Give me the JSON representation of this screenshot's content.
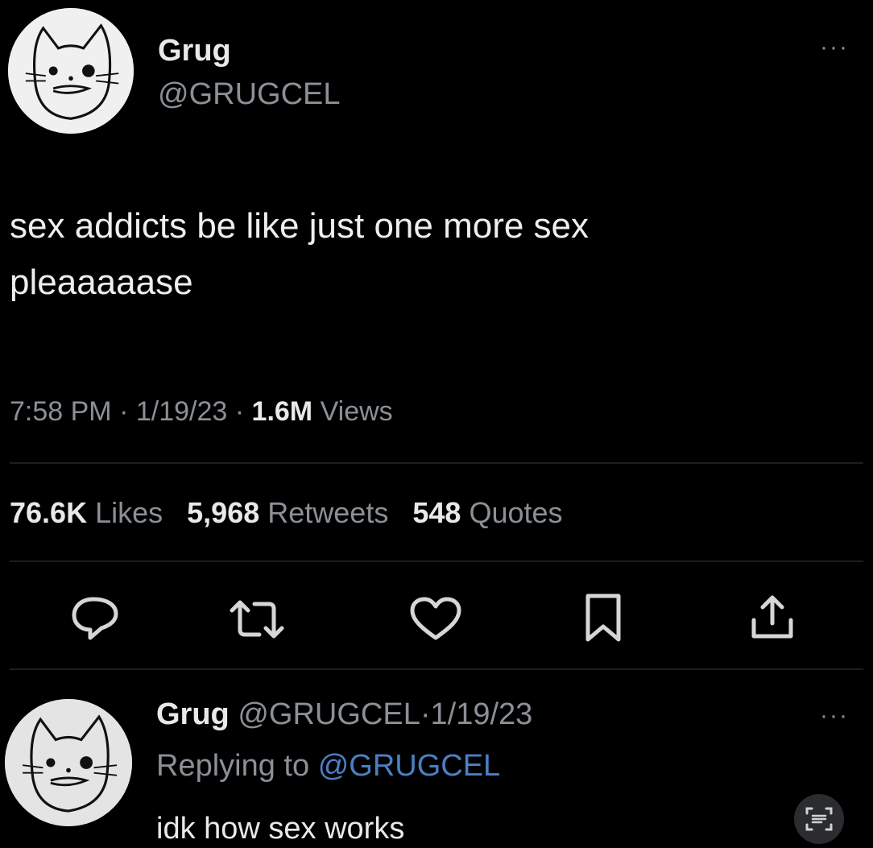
{
  "tweet": {
    "display_name": "Grug",
    "handle": "@GRUGCEL",
    "text_line1": "sex addicts be like just one more sex",
    "text_line2": "pleaaaaase",
    "time": "7:58 PM",
    "date": "1/19/23",
    "views_count": "1.6M",
    "views_label": "Views",
    "likes_count": "76.6K",
    "likes_label": "Likes",
    "retweets_count": "5,968",
    "retweets_label": "Retweets",
    "quotes_count": "548",
    "quotes_label": "Quotes",
    "more_label": "···",
    "separator": "·"
  },
  "actions": {
    "reply_icon": "speech-bubble-icon",
    "retweet_icon": "retweet-arrows-icon",
    "like_icon": "heart-icon",
    "bookmark_icon": "bookmark-icon",
    "share_icon": "share-arrow-icon"
  },
  "reply": {
    "display_name": "Grug",
    "handle": "@GRUGCEL",
    "date": "1/19/23",
    "replying_prefix": "Replying to",
    "replying_handle": "@GRUGCEL",
    "text": "idk how sex works",
    "more_label": "···"
  },
  "colors": {
    "background": "#000000",
    "text": "#e7e9ea",
    "muted": "#8b9096",
    "link": "#4b7fc4"
  }
}
